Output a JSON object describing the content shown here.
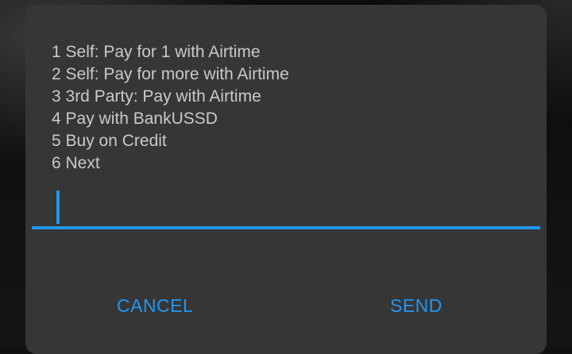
{
  "dialog": {
    "options": [
      "1 Self: Pay for 1 with Airtime",
      "2 Self: Pay for more with Airtime",
      "3 3rd Party: Pay with Airtime",
      "4 Pay with BankUSSD",
      "5 Buy on Credit",
      "6 Next"
    ],
    "input": {
      "value": "",
      "placeholder": ""
    },
    "cancel_label": "CANCEL",
    "send_label": "SEND"
  },
  "colors": {
    "dialog_background": "#363636",
    "text": "#c9c9c9",
    "accent": "#2196f3"
  }
}
